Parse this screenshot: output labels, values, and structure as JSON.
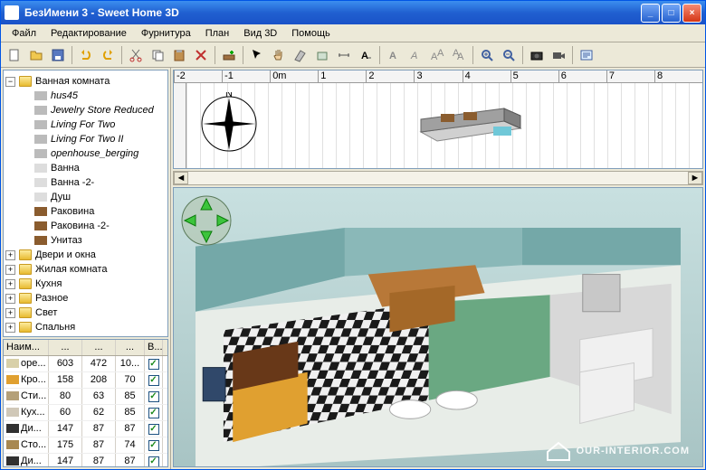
{
  "window": {
    "title": "БезИмени 3 - Sweet Home 3D"
  },
  "menu": {
    "file": "Файл",
    "edit": "Редактирование",
    "furniture": "Фурнитура",
    "plan": "План",
    "view3d": "Вид 3D",
    "help": "Помощь"
  },
  "tree": {
    "root": "Ванная комната",
    "children": [
      "hus45",
      "Jewelry Store Reduced",
      "Living For Two",
      "Living For Two II",
      "openhouse_berging",
      "Ванна",
      "Ванна -2-",
      "Душ",
      "Раковина",
      "Раковина -2-",
      "Унитаз"
    ],
    "folders": [
      "Двери и окна",
      "Жилая комната",
      "Кухня",
      "Разное",
      "Свет",
      "Спальня"
    ]
  },
  "table": {
    "headers": [
      "Наим...",
      "...",
      "...",
      "...",
      "В..."
    ],
    "rows": [
      {
        "icon": "#d8d0a8",
        "name": "оре...",
        "c1": 603,
        "c2": 472,
        "c3": "10...",
        "v": true
      },
      {
        "icon": "#e0a030",
        "name": "Кро...",
        "c1": 158,
        "c2": 208,
        "c3": 70,
        "v": true
      },
      {
        "icon": "#b4a078",
        "name": "Сти...",
        "c1": 80,
        "c2": 63,
        "c3": 85,
        "v": true
      },
      {
        "icon": "#d0c8b8",
        "name": "Кух...",
        "c1": 60,
        "c2": 62,
        "c3": 85,
        "v": true
      },
      {
        "icon": "#303030",
        "name": "Ди...",
        "c1": 147,
        "c2": 87,
        "c3": 87,
        "v": true
      },
      {
        "icon": "#a88850",
        "name": "Сто...",
        "c1": 175,
        "c2": 87,
        "c3": 74,
        "v": true
      },
      {
        "icon": "#303030",
        "name": "Ди...",
        "c1": 147,
        "c2": 87,
        "c3": 87,
        "v": true
      }
    ]
  },
  "ruler": {
    "marks": [
      "-2",
      "-1",
      "0m",
      "1",
      "2",
      "3",
      "4",
      "5",
      "6",
      "7",
      "8"
    ]
  },
  "watermark": {
    "text": "OUR-INTERIOR.COM"
  }
}
